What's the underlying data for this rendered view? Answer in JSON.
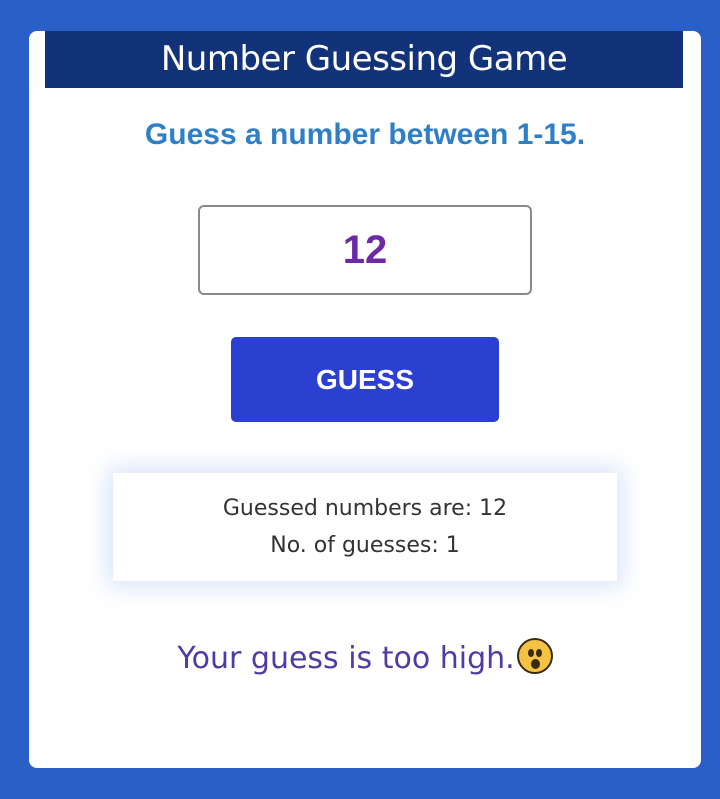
{
  "header": {
    "title": "Number Guessing Game"
  },
  "prompt": {
    "text": "Guess a number between 1-15."
  },
  "guess_input": {
    "value": "12"
  },
  "guess_button": {
    "label": "GUESS"
  },
  "info": {
    "guessed_numbers": "Guessed numbers are: 12",
    "guess_count": "No. of guesses: 1"
  },
  "result": {
    "message": "Your guess is too high.",
    "icon": "surprised-face-icon"
  },
  "colors": {
    "background": "#2b5fc8",
    "header": "#12327a",
    "prompt": "#2f7fc6",
    "input_text": "#6d2aa6",
    "button": "#2b3fd0",
    "result_text": "#4a3ea6"
  }
}
